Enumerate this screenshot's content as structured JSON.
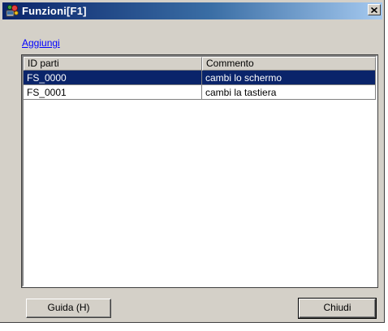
{
  "window": {
    "title": "Funzioni[F1]",
    "icon": "app-functions-icon"
  },
  "toolbar": {
    "add_link": "Aggiungi"
  },
  "list": {
    "columns": [
      "ID parti",
      "Commento"
    ],
    "rows": [
      {
        "id": "FS_0000",
        "comment": "cambi lo schermo",
        "selected": true
      },
      {
        "id": "FS_0001",
        "comment": "cambi la tastiera",
        "selected": false
      }
    ]
  },
  "buttons": {
    "help_label": "Guida (H)",
    "close_label": "Chiudi"
  },
  "colors": {
    "title_bar": "#0a246a",
    "selection": "#0a246a",
    "face": "#d4d0c8",
    "link": "#0000ff"
  }
}
